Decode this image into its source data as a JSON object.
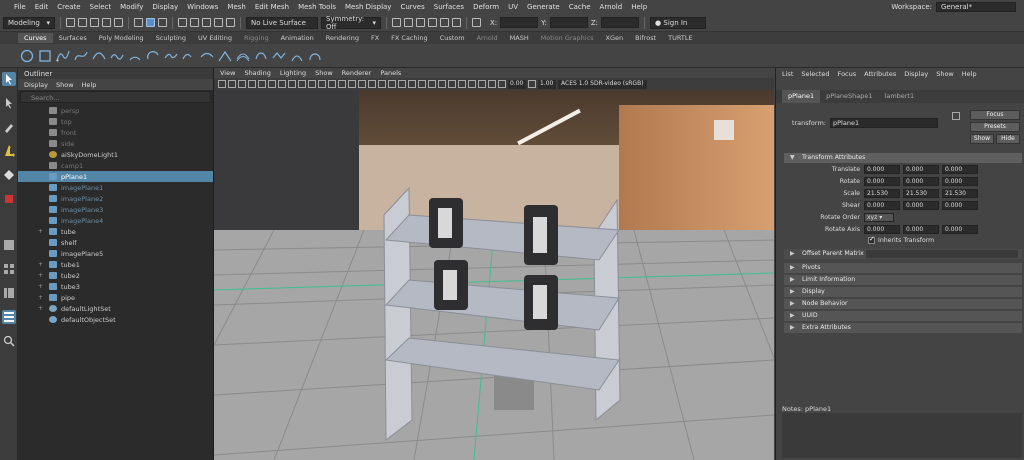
{
  "menubar": {
    "items": [
      "File",
      "Edit",
      "Create",
      "Select",
      "Modify",
      "Display",
      "Windows",
      "Mesh",
      "Edit Mesh",
      "Mesh Tools",
      "Mesh Display",
      "Curves",
      "Surfaces",
      "Deform",
      "UV",
      "Generate",
      "Cache",
      "Arnold",
      "Help"
    ],
    "workspace_label": "Workspace:",
    "workspace_value": "General*"
  },
  "statusline": {
    "menuset": "Modeling",
    "live_surface": "No Live Surface",
    "symmetry": "Symmetry: Off",
    "x_label": "X:",
    "y_label": "Y:",
    "z_label": "Z:",
    "signin": "Sign In"
  },
  "shelf": {
    "tabs": [
      "Curves",
      "Surfaces",
      "Poly Modeling",
      "Sculpting",
      "UV Editing",
      "Rigging",
      "Animation",
      "Rendering",
      "FX",
      "FX Caching",
      "Custom",
      "Arnold",
      "MASH",
      "Motion Graphics",
      "XGen",
      "Bifrost",
      "TURTLE"
    ],
    "active_tab": "Curves"
  },
  "outliner": {
    "title": "Outliner",
    "menu": [
      "Display",
      "Show",
      "Help"
    ],
    "search_placeholder": "Search...",
    "items": [
      {
        "label": "persp",
        "style": "grey",
        "icon": "camera-icon",
        "exp": ""
      },
      {
        "label": "top",
        "style": "grey",
        "icon": "camera-icon",
        "exp": ""
      },
      {
        "label": "front",
        "style": "grey",
        "icon": "camera-icon",
        "exp": ""
      },
      {
        "label": "side",
        "style": "grey",
        "icon": "camera-icon",
        "exp": ""
      },
      {
        "label": "aiSkyDomeLight1",
        "style": "",
        "icon": "light-icon",
        "exp": ""
      },
      {
        "label": "camp1",
        "style": "grey",
        "icon": "camera-icon",
        "exp": ""
      },
      {
        "label": "pPlane1",
        "style": "selected",
        "icon": "mesh-icon",
        "exp": ""
      },
      {
        "label": "imagePlane1",
        "style": "hidden",
        "icon": "image-plane-icon",
        "exp": ""
      },
      {
        "label": "imagePlane2",
        "style": "hidden",
        "icon": "image-plane-icon",
        "exp": ""
      },
      {
        "label": "imagePlane3",
        "style": "hidden",
        "icon": "image-plane-icon",
        "exp": ""
      },
      {
        "label": "imagePlane4",
        "style": "hidden",
        "icon": "image-plane-icon",
        "exp": ""
      },
      {
        "label": "tube",
        "style": "",
        "icon": "mesh-icon",
        "exp": "+"
      },
      {
        "label": "shelf",
        "style": "",
        "icon": "mesh-icon",
        "exp": ""
      },
      {
        "label": "imagePlane5",
        "style": "",
        "icon": "image-plane-icon",
        "exp": ""
      },
      {
        "label": "tube1",
        "style": "",
        "icon": "mesh-icon",
        "exp": "+"
      },
      {
        "label": "tube2",
        "style": "",
        "icon": "mesh-icon",
        "exp": "+"
      },
      {
        "label": "tube3",
        "style": "",
        "icon": "mesh-icon",
        "exp": "+"
      },
      {
        "label": "pipe",
        "style": "",
        "icon": "mesh-icon",
        "exp": "+"
      },
      {
        "label": "defaultLightSet",
        "style": "",
        "icon": "set-icon",
        "exp": "+"
      },
      {
        "label": "defaultObjectSet",
        "style": "",
        "icon": "set-icon",
        "exp": ""
      }
    ]
  },
  "viewport": {
    "menu": [
      "View",
      "Shading",
      "Lighting",
      "Show",
      "Renderer",
      "Panels"
    ],
    "exposure": "0.00",
    "gamma": "1.00",
    "color_space": "ACES 1.0 SDR-video (sRGB)"
  },
  "attribute_editor": {
    "menu": [
      "List",
      "Selected",
      "Focus",
      "Attributes",
      "Display",
      "Show",
      "Help"
    ],
    "tabs": [
      "pPlane1",
      "pPlaneShape1",
      "lambert1"
    ],
    "active_tab": "pPlane1",
    "transform_label": "transform:",
    "transform_value": "pPlane1",
    "focus_btn": "Focus",
    "presets_btn": "Presets",
    "show_btn": "Show",
    "hide_btn": "Hide",
    "section_transform": "Transform Attributes",
    "translate_label": "Translate",
    "translate": [
      "0.000",
      "0.000",
      "0.000"
    ],
    "rotate_label": "Rotate",
    "rotate": [
      "0.000",
      "0.000",
      "0.000"
    ],
    "scale_label": "Scale",
    "scale": [
      "21.530",
      "21.530",
      "21.530"
    ],
    "shear_label": "Shear",
    "shear": [
      "0.000",
      "0.000",
      "0.000"
    ],
    "rotate_order_label": "Rotate Order",
    "rotate_order": "xyz",
    "rotate_axis_label": "Rotate Axis",
    "rotate_axis": [
      "0.000",
      "0.000",
      "0.000"
    ],
    "inherits_transform": "Inherits Transform",
    "offset_parent_matrix": "Offset Parent Matrix",
    "sections": [
      "Pivots",
      "Limit Information",
      "Display",
      "Node Behavior",
      "UUID",
      "Extra Attributes"
    ],
    "notes_label": "Notes: pPlane1"
  }
}
